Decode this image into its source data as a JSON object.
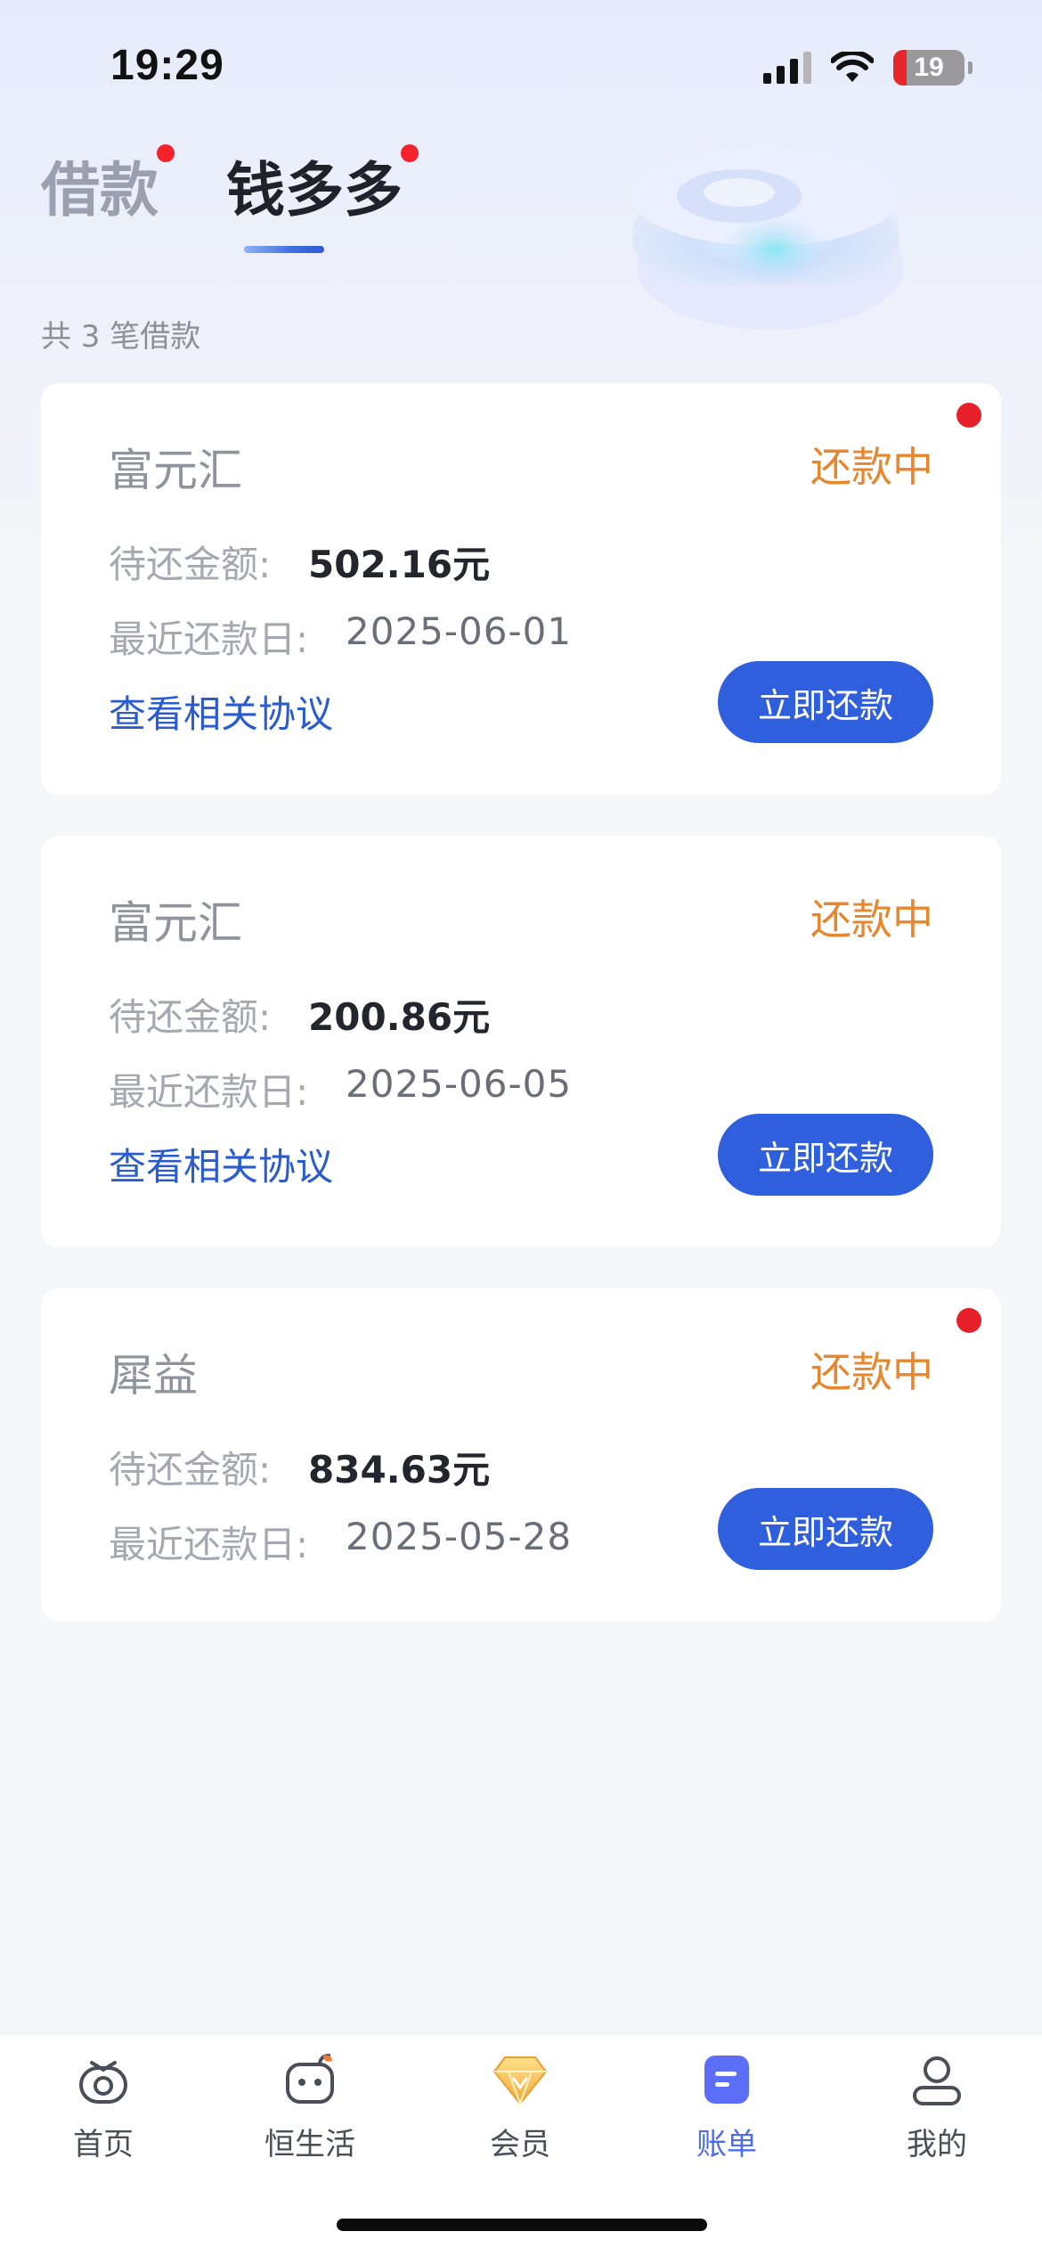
{
  "status_bar": {
    "time": "19:29",
    "battery": "19",
    "battery_level": 0.19
  },
  "tabs": [
    {
      "label": "借款",
      "active": false,
      "has_badge": true
    },
    {
      "label": "钱多多",
      "active": true,
      "has_badge": true
    }
  ],
  "summary": {
    "total_text": "共 3 笔借款"
  },
  "loans": [
    {
      "lender": "富元汇",
      "status": "还款中",
      "amount_label": "待还金额:",
      "amount": "502.16元",
      "date_label": "最近还款日:",
      "date": "2025-06-01",
      "agreement_link": "查看相关协议",
      "pay_label": "立即还款",
      "has_badge": true
    },
    {
      "lender": "富元汇",
      "status": "还款中",
      "amount_label": "待还金额:",
      "amount": "200.86元",
      "date_label": "最近还款日:",
      "date": "2025-06-05",
      "agreement_link": "查看相关协议",
      "pay_label": "立即还款",
      "has_badge": false
    },
    {
      "lender": "犀益",
      "status": "还款中",
      "amount_label": "待还金额:",
      "amount": "834.63元",
      "date_label": "最近还款日:",
      "date": "2025-05-28",
      "pay_label": "立即还款",
      "has_badge": true
    }
  ],
  "bottom_nav": [
    {
      "label": "首页",
      "icon": "home-money-icon",
      "active": false
    },
    {
      "label": "恒生活",
      "icon": "life-robot-icon",
      "active": false
    },
    {
      "label": "会员",
      "icon": "member-diamond-icon",
      "active": false
    },
    {
      "label": "账单",
      "icon": "bill-icon",
      "active": true
    },
    {
      "label": "我的",
      "icon": "profile-icon",
      "active": false
    }
  ],
  "colors": {
    "accent": "#2f5fdc",
    "status_orange": "#e8862e",
    "badge_red": "#e8202a",
    "nav_active": "#4b6cf0"
  }
}
